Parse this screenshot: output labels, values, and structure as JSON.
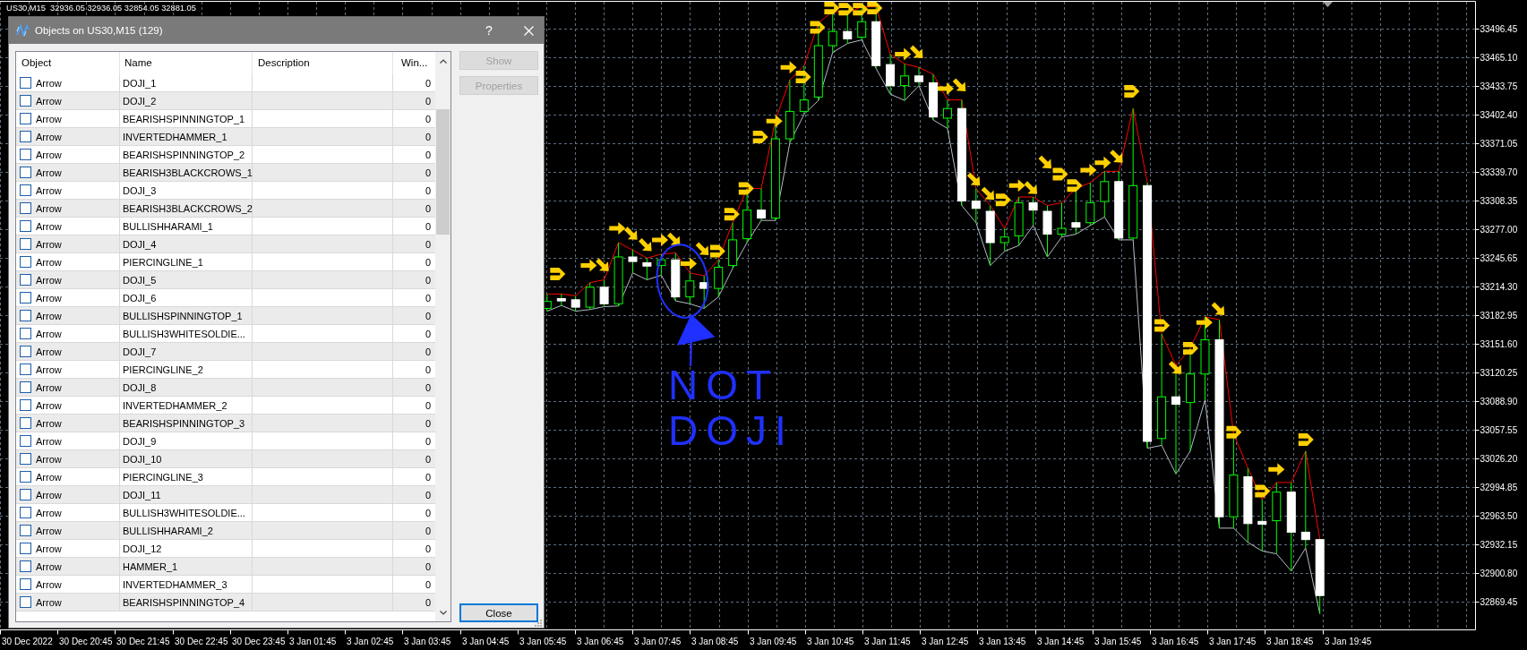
{
  "chart": {
    "header": {
      "symbol": "US30,M15",
      "values": [
        "32936.05",
        "32936.05",
        "32854.05",
        "32881.05"
      ]
    },
    "price_labels": [
      "33496.45",
      "33465.10",
      "33433.75",
      "33402.40",
      "33371.05",
      "33339.70",
      "33308.35",
      "33277.00",
      "33245.65",
      "33214.30",
      "33182.95",
      "33151.60",
      "33120.25",
      "33088.90",
      "33057.55",
      "33026.20",
      "32994.85",
      "32963.50",
      "32932.15",
      "32900.80",
      "32869.45"
    ],
    "time_labels": [
      "30 Dec 2022",
      "30 Dec 20:45",
      "30 Dec 21:45",
      "30 Dec 22:45",
      "30 Dec 23:45",
      "3 Jan 01:45",
      "3 Jan 02:45",
      "3 Jan 03:45",
      "3 Jan 04:45",
      "3 Jan 05:45",
      "3 Jan 06:45",
      "3 Jan 07:45",
      "3 Jan 08:45",
      "3 Jan 09:45",
      "3 Jan 10:45",
      "3 Jan 11:45",
      "3 Jan 12:45",
      "3 Jan 13:45",
      "3 Jan 14:45",
      "3 Jan 15:45",
      "3 Jan 16:45",
      "3 Jan 17:45",
      "3 Jan 18:45",
      "3 Jan 19:45"
    ],
    "annotation": {
      "lines": [
        "NOT",
        "DOJI"
      ]
    }
  },
  "dialog": {
    "title": "Objects on US30,M15 (129)",
    "help_button": "?",
    "columns": [
      "Object",
      "Name",
      "Description",
      "Win..."
    ],
    "rows": [
      {
        "checked": false,
        "object": "Arrow",
        "name": "DOJI_1",
        "window": "0"
      },
      {
        "checked": false,
        "object": "Arrow",
        "name": "DOJI_2",
        "window": "0"
      },
      {
        "checked": false,
        "object": "Arrow",
        "name": "BEARISHSPINNINGTOP_1",
        "window": "0"
      },
      {
        "checked": false,
        "object": "Arrow",
        "name": "INVERTEDHAMMER_1",
        "window": "0"
      },
      {
        "checked": false,
        "object": "Arrow",
        "name": "BEARISHSPINNINGTOP_2",
        "window": "0"
      },
      {
        "checked": false,
        "object": "Arrow",
        "name": "BEARISH3BLACKCROWS_1",
        "window": "0"
      },
      {
        "checked": false,
        "object": "Arrow",
        "name": "DOJI_3",
        "window": "0"
      },
      {
        "checked": false,
        "object": "Arrow",
        "name": "BEARISH3BLACKCROWS_2",
        "window": "0"
      },
      {
        "checked": false,
        "object": "Arrow",
        "name": "BULLISHHARAMI_1",
        "window": "0"
      },
      {
        "checked": false,
        "object": "Arrow",
        "name": "DOJI_4",
        "window": "0"
      },
      {
        "checked": false,
        "object": "Arrow",
        "name": "PIERCINGLINE_1",
        "window": "0"
      },
      {
        "checked": false,
        "object": "Arrow",
        "name": "DOJI_5",
        "window": "0"
      },
      {
        "checked": false,
        "object": "Arrow",
        "name": "DOJI_6",
        "window": "0"
      },
      {
        "checked": false,
        "object": "Arrow",
        "name": "BULLISHSPINNINGTOP_1",
        "window": "0"
      },
      {
        "checked": false,
        "object": "Arrow",
        "name": "BULLISH3WHITESOLDIE...",
        "window": "0"
      },
      {
        "checked": false,
        "object": "Arrow",
        "name": "DOJI_7",
        "window": "0"
      },
      {
        "checked": false,
        "object": "Arrow",
        "name": "PIERCINGLINE_2",
        "window": "0"
      },
      {
        "checked": false,
        "object": "Arrow",
        "name": "DOJI_8",
        "window": "0"
      },
      {
        "checked": false,
        "object": "Arrow",
        "name": "INVERTEDHAMMER_2",
        "window": "0"
      },
      {
        "checked": false,
        "object": "Arrow",
        "name": "BEARISHSPINNINGTOP_3",
        "window": "0"
      },
      {
        "checked": false,
        "object": "Arrow",
        "name": "DOJI_9",
        "window": "0"
      },
      {
        "checked": false,
        "object": "Arrow",
        "name": "DOJI_10",
        "window": "0"
      },
      {
        "checked": false,
        "object": "Arrow",
        "name": "PIERCINGLINE_3",
        "window": "0"
      },
      {
        "checked": false,
        "object": "Arrow",
        "name": "DOJI_11",
        "window": "0"
      },
      {
        "checked": false,
        "object": "Arrow",
        "name": "BULLISH3WHITESOLDIE...",
        "window": "0"
      },
      {
        "checked": false,
        "object": "Arrow",
        "name": "BULLISHHARAMI_2",
        "window": "0"
      },
      {
        "checked": false,
        "object": "Arrow",
        "name": "DOJI_12",
        "window": "0"
      },
      {
        "checked": false,
        "object": "Arrow",
        "name": "HAMMER_1",
        "window": "0"
      },
      {
        "checked": false,
        "object": "Arrow",
        "name": "INVERTEDHAMMER_3",
        "window": "0"
      },
      {
        "checked": false,
        "object": "Arrow",
        "name": "BEARISHSPINNINGTOP_4",
        "window": "0"
      }
    ],
    "side_buttons": [
      {
        "label": "Show",
        "disabled": true
      },
      {
        "label": "Properties",
        "disabled": true
      }
    ],
    "close_button": {
      "label": "Close",
      "disabled": false,
      "focused": true
    }
  }
}
